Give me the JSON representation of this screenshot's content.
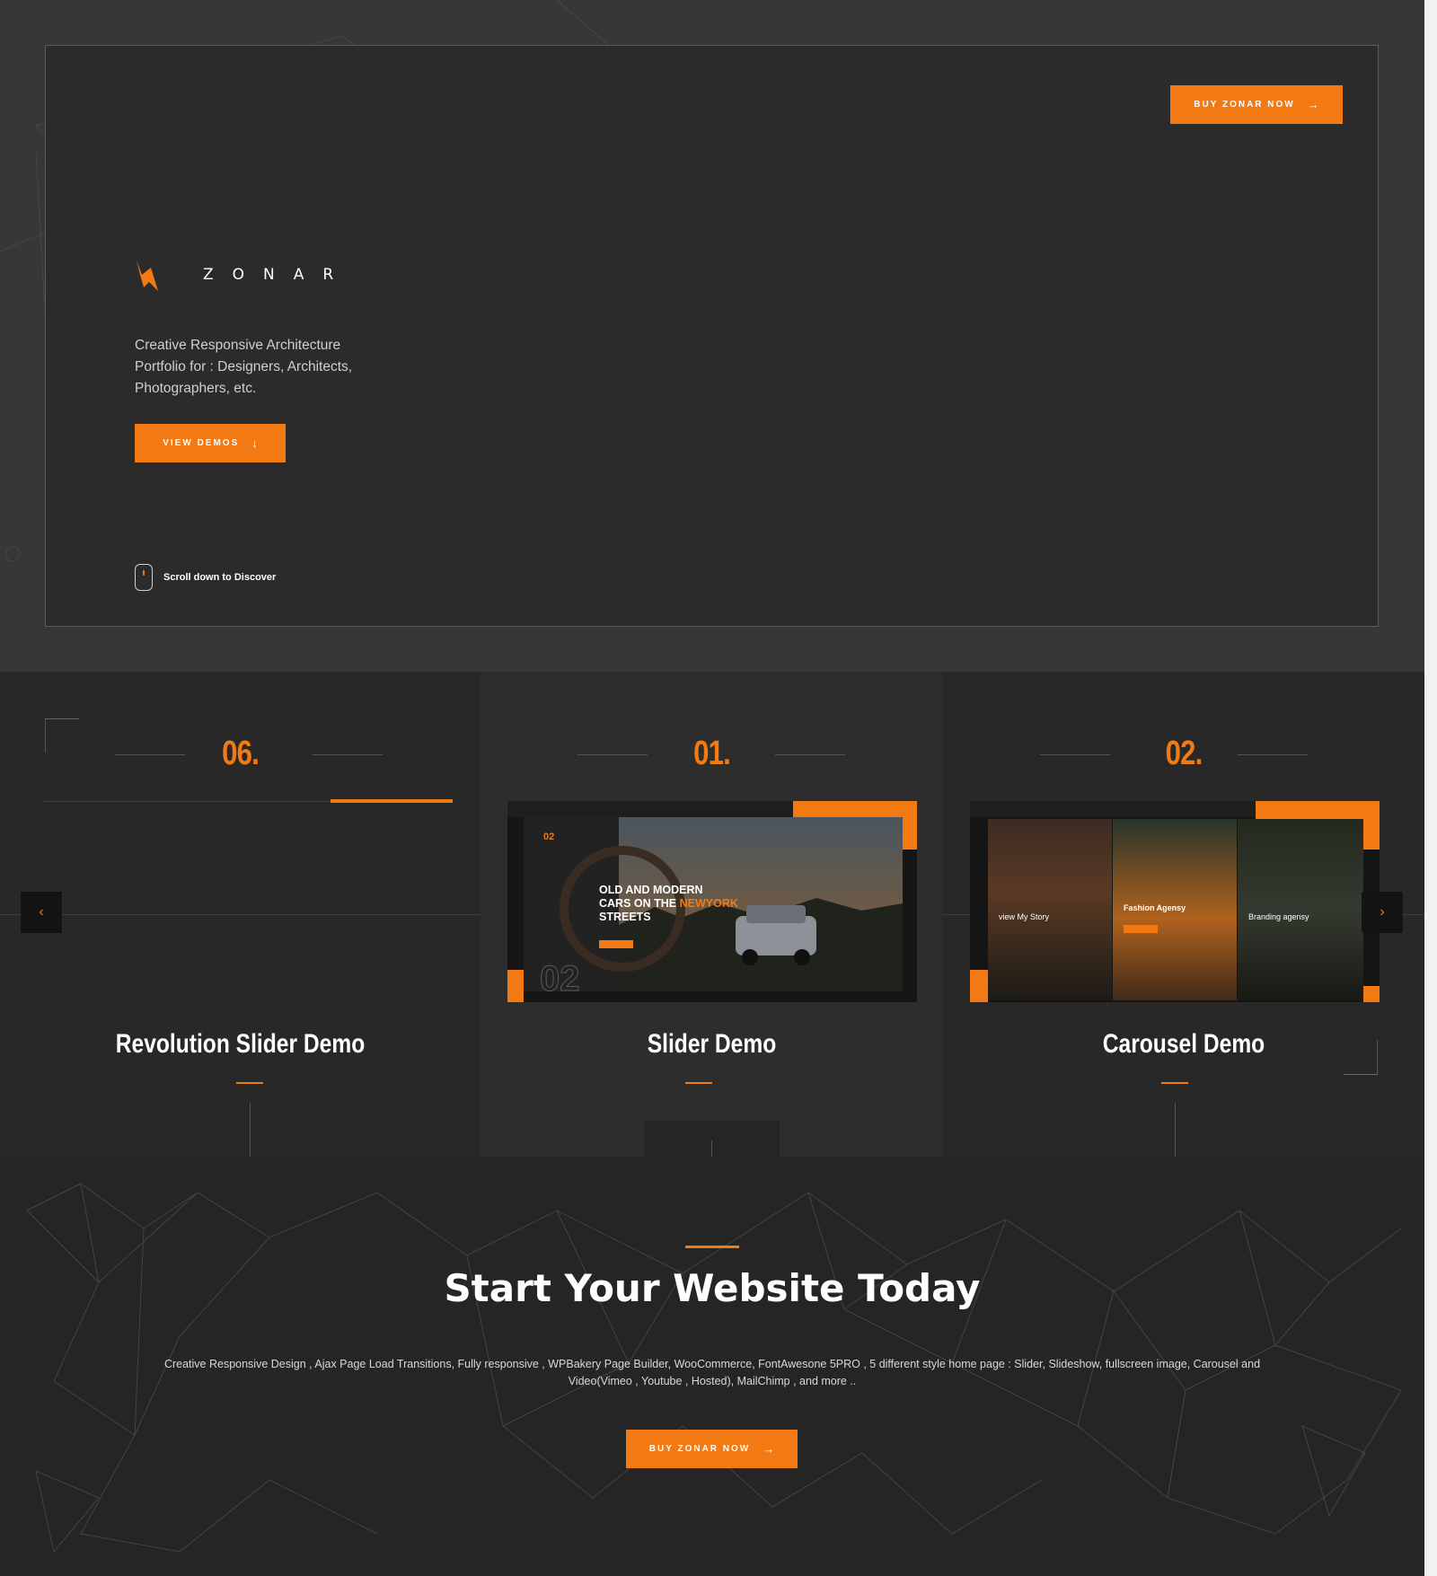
{
  "colors": {
    "accent": "#f37a12",
    "background": "#2a2a2a",
    "hero_bg": "#2b2b2c"
  },
  "hero": {
    "logo_text": "ZONAR",
    "description": "Creative Responsive Architecture Portfolio for : Designers, Architects, Photographers, etc.",
    "view_demos_label": "VIEW DEMOS",
    "buy_label": "BUY ZONAR NOW",
    "scroll_hint": "Scroll down to Discover"
  },
  "demos": [
    {
      "number": "06.",
      "title": "Revolution Slider Demo"
    },
    {
      "number": "01.",
      "title": "Slider Demo",
      "thumb": {
        "slide_no": "02",
        "headline_1": "OLD AND MODERN",
        "headline_2": "CARS ON THE",
        "headline_accent": "NEWYORK",
        "headline_3": "STREETS",
        "big_no": "02"
      }
    },
    {
      "number": "02.",
      "title": "Carousel Demo",
      "thumb": {
        "panels": [
          "view My Story",
          "Fashion Agensy",
          "Branding agensy"
        ]
      }
    }
  ],
  "cta": {
    "title": "Start Your Website Today",
    "description": "Creative Responsive Design , Ajax Page Load Transitions, Fully responsive , WPBakery Page Builder, WooCommerce, FontAwesone 5PRO , 5 different style home page : Slider, Slideshow, fullscreen image, Carousel and Video(Vimeo , Youtube , Hosted), MailChimp , and more ..",
    "buy_label": "BUY ZONAR NOW"
  },
  "nav": {
    "prev_icon": "chevron-left-icon",
    "next_icon": "chevron-right-icon"
  }
}
